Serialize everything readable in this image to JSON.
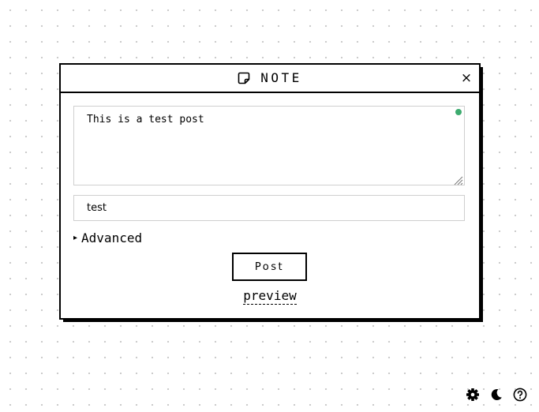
{
  "modal": {
    "title": "NOTE",
    "close_label": "×",
    "icon": "sticky-note-icon"
  },
  "editor": {
    "text": "This is a test post",
    "status_color": "#3dab6f"
  },
  "tags": {
    "value": "test"
  },
  "advanced": {
    "label": "Advanced",
    "toggle": "▸"
  },
  "actions": {
    "post_label": "Post",
    "preview_label": "preview"
  },
  "footer_icons": [
    "gear-icon",
    "moon-icon",
    "help-icon"
  ]
}
